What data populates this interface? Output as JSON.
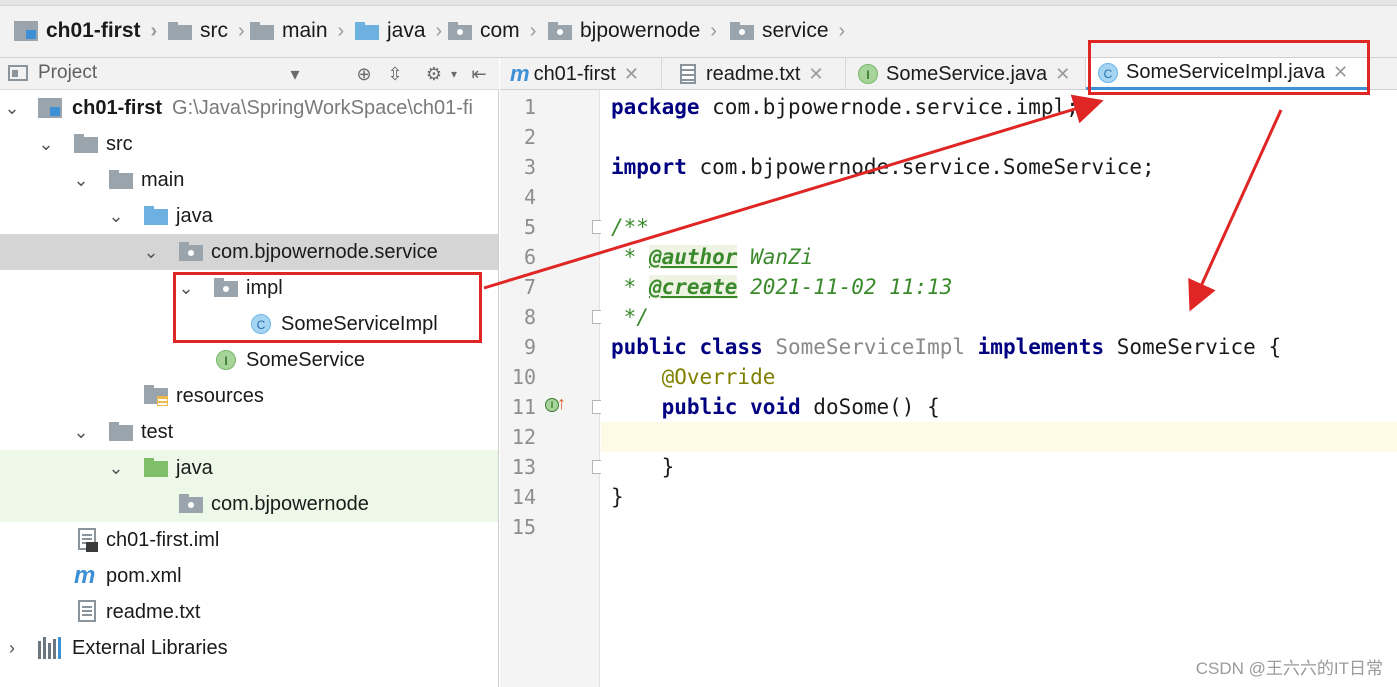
{
  "breadcrumb": {
    "items": [
      "ch01-first",
      "src",
      "main",
      "java",
      "com",
      "bjpowernode",
      "service"
    ],
    "separator": "›"
  },
  "project_panel": {
    "title": "Project",
    "tree": [
      {
        "label": "ch01-first",
        "path": "G:\\Java\\SpringWorkSpace\\ch01-fi",
        "icon": "module-icon"
      },
      {
        "label": "src",
        "icon": "folder-icon"
      },
      {
        "label": "main",
        "icon": "folder-icon"
      },
      {
        "label": "java",
        "icon": "source-folder-icon"
      },
      {
        "label": "com.bjpowernode.service",
        "icon": "package-icon"
      },
      {
        "label": "impl",
        "icon": "package-icon"
      },
      {
        "label": "SomeServiceImpl",
        "icon": "class-icon",
        "badge": "C"
      },
      {
        "label": "SomeService",
        "icon": "interface-icon",
        "badge": "I"
      },
      {
        "label": "resources",
        "icon": "resources-folder-icon"
      },
      {
        "label": "test",
        "icon": "folder-icon"
      },
      {
        "label": "java",
        "icon": "test-source-folder-icon"
      },
      {
        "label": "com.bjpowernode",
        "icon": "package-icon"
      },
      {
        "label": "ch01-first.iml",
        "icon": "iml-file-icon"
      },
      {
        "label": "pom.xml",
        "icon": "maven-icon"
      },
      {
        "label": "readme.txt",
        "icon": "text-file-icon"
      },
      {
        "label": "External Libraries",
        "icon": "libraries-icon"
      }
    ]
  },
  "tabs": [
    {
      "label": "ch01-first",
      "icon": "maven-icon"
    },
    {
      "label": "readme.txt",
      "icon": "text-file-icon"
    },
    {
      "label": "SomeService.java",
      "icon": "interface-icon",
      "badge": "I"
    },
    {
      "label": "SomeServiceImpl.java",
      "icon": "class-icon",
      "badge": "C",
      "active": true
    }
  ],
  "editor": {
    "line_numbers": [
      "1",
      "2",
      "3",
      "4",
      "5",
      "6",
      "7",
      "8",
      "9",
      "10",
      "11",
      "12",
      "13",
      "14",
      "15"
    ],
    "code": {
      "l1_kw": "package",
      "l1_rest": " com.bjpowernode.service.impl;",
      "l3_kw": "import",
      "l3_rest": " com.bjpowernode.service.SomeService;",
      "l5": "/**",
      "l6_star": " * ",
      "l6_tag": "@author",
      "l6_val": " WanZi",
      "l7_star": " * ",
      "l7_tag": "@create",
      "l7_val": " 2021-11-02 11:13",
      "l8": " */",
      "l9_kw1": "public class",
      "l9_cls": " SomeServiceImpl ",
      "l9_kw2": "implements",
      "l9_rest": " SomeService {",
      "l10": "    @Override",
      "l11_kw": "    public void",
      "l11_rest": " doSome() {",
      "l13": "    }",
      "l14": "}"
    }
  },
  "gutter_marker": "I↑",
  "watermark": "CSDN @王六六的IT日常",
  "colors": {
    "annotation_red": "#e02525",
    "keyword": "#000080",
    "doc_comment": "#3a8a2c"
  }
}
